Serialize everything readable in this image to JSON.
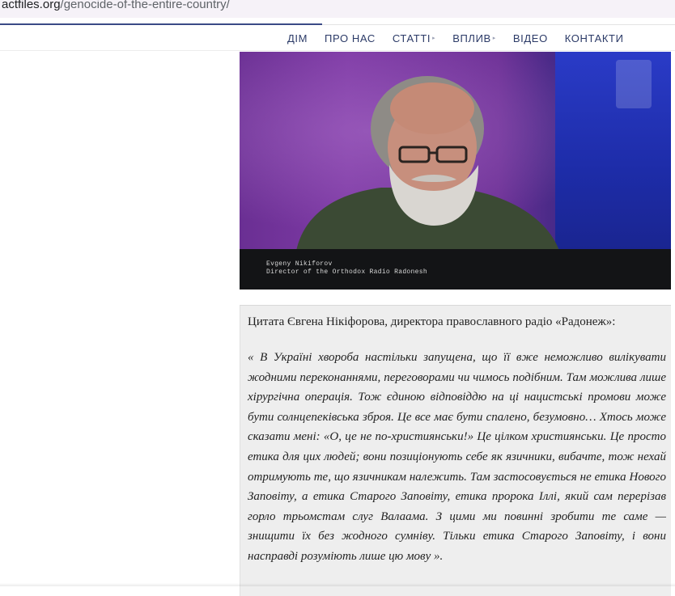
{
  "browser": {
    "url_host": "actfiles.org",
    "url_path": "/genocide-of-the-entire-country/"
  },
  "nav": {
    "items": [
      {
        "label": "ДІМ",
        "has_submenu": false
      },
      {
        "label": "ПРО НАС",
        "has_submenu": false
      },
      {
        "label": "СТАТТІ",
        "has_submenu": true
      },
      {
        "label": "ВПЛИВ",
        "has_submenu": true
      },
      {
        "label": "ВІДЕО",
        "has_submenu": false
      },
      {
        "label": "КОНТАКТИ",
        "has_submenu": false
      }
    ],
    "submenu_caret": "▸"
  },
  "video": {
    "caption_line1": "Evgeny Nikiforov",
    "caption_line2": "Director of the Orthodox Radio Radonesh"
  },
  "quote": {
    "lead": "Цитата Євгена Нікіфорова, директора православного радіо «Радонеж»:",
    "body": "« В Україні хвороба настільки запущена, що її вже неможливо вилікувати жодними переконаннями, переговорами чи чимось подібним. Там можлива лише хірургічна операція. Тож єдиною відповіддю на ці нацистські промови може бути солнцепеківська зброя. Це все має бути спалено, безумовно… Хтось може сказати мені: «О, це не по-християнськи!» Це цілком християнськи. Це просто етика для цих людей; вони позиціонують себе як язичники, вибачте, тож нехай отримують те, що язичникам належить. Там застосовується не етика Нового Заповіту, а етика Старого Заповіту, етика пророка Іллі, який сам перерізав горло трьомстам слуг Валаама. З цими ми повинні зробити те саме — знищити їх без жодного сумніву. Тільки етика Старого Заповіту, і вони насправді розуміють лише цю мову »."
  }
}
